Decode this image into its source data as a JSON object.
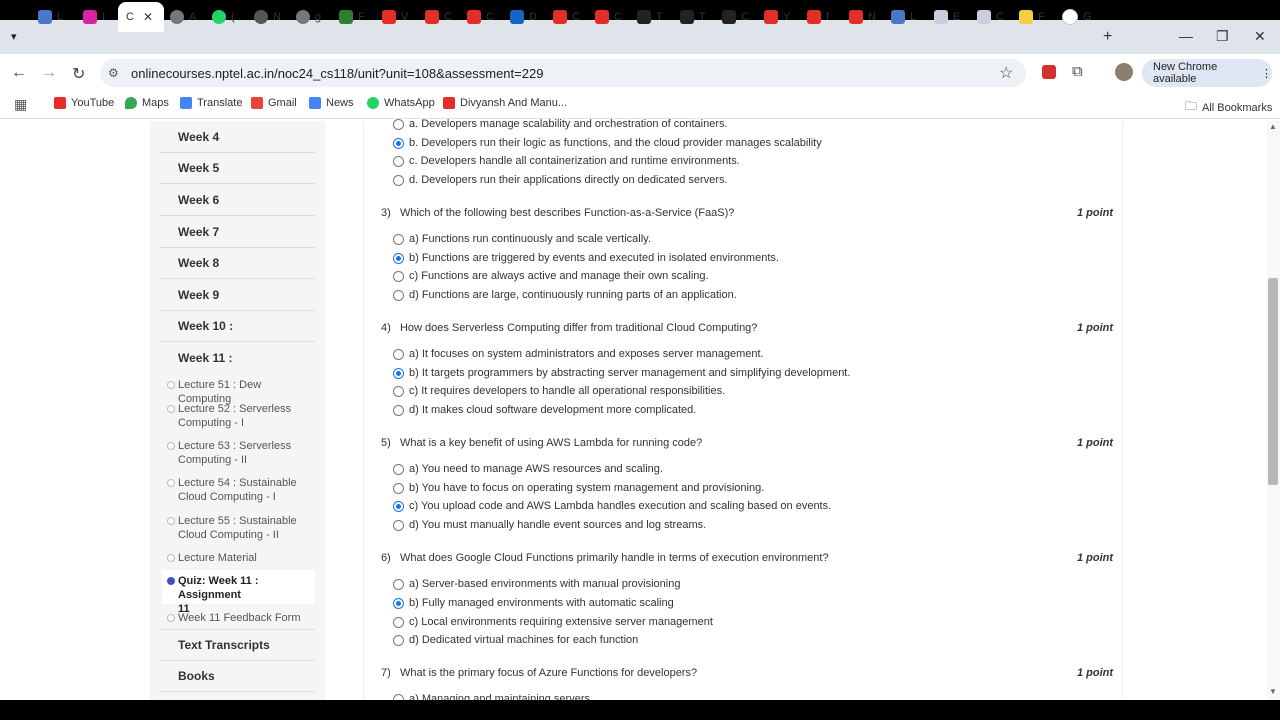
{
  "browser": {
    "tabs": [
      {
        "label": "L"
      },
      {
        "label": "I"
      },
      {
        "label": "C"
      },
      {
        "label": "A"
      },
      {
        "label": "("
      },
      {
        "label": "N"
      },
      {
        "label": "g"
      },
      {
        "label": "F"
      },
      {
        "label": "V"
      },
      {
        "label": "C"
      },
      {
        "label": "C"
      },
      {
        "label": "D"
      },
      {
        "label": "C"
      },
      {
        "label": "C"
      },
      {
        "label": "T"
      },
      {
        "label": "T"
      },
      {
        "label": "C"
      },
      {
        "label": "Y"
      },
      {
        "label": "f"
      },
      {
        "label": "N"
      },
      {
        "label": "L"
      },
      {
        "label": "E"
      },
      {
        "label": "C"
      },
      {
        "label": "F"
      },
      {
        "label": "G"
      }
    ],
    "url": "onlinecourses.nptel.ac.in/noc24_cs118/unit?unit=108&assessment=229",
    "new_chrome": "New Chrome available",
    "bookmarks": [
      "YouTube",
      "Maps",
      "Translate",
      "Gmail",
      "News",
      "WhatsApp",
      "Divyansh And Manu..."
    ],
    "all_bookmarks": "All Bookmarks"
  },
  "sidebar": {
    "weeks": [
      "Week 4",
      "Week 5",
      "Week 6",
      "Week 7",
      "Week 8",
      "Week 9",
      "Week 10 :",
      "Week 11 :"
    ],
    "lectures": [
      {
        "line1": "Lecture 51 : Dew Computing",
        "line2": ""
      },
      {
        "line1": "Lecture 52 : Serverless",
        "line2": "Computing - I"
      },
      {
        "line1": "Lecture 53 : Serverless",
        "line2": "Computing - II"
      },
      {
        "line1": "Lecture 54 : Sustainable",
        "line2": "Cloud Computing - I"
      },
      {
        "line1": "Lecture 55 : Sustainable",
        "line2": "Cloud Computing - II"
      },
      {
        "line1": "Lecture Material",
        "line2": ""
      },
      {
        "line1": "Quiz: Week 11 : Assignment",
        "line2": "11"
      },
      {
        "line1": "Week 11 Feedback Form",
        "line2": ""
      }
    ],
    "text_transcripts": "Text Transcripts",
    "books": "Books"
  },
  "quiz": {
    "point_label": "1 point",
    "q2_options": [
      "a. Developers manage scalability and orchestration of containers.",
      "b. Developers run their logic as functions, and the cloud provider manages scalability",
      "c. Developers handle all containerization and runtime environments.",
      "d. Developers run their applications directly on dedicated servers."
    ],
    "questions": [
      {
        "number": "3)",
        "text": "Which of the following best describes Function-as-a-Service (FaaS)?",
        "options": [
          "a) Functions run continuously and scale vertically.",
          "b) Functions are triggered by events and executed in isolated environments.",
          "c) Functions are always active and manage their own scaling.",
          "d) Functions are large, continuously running parts of an application."
        ]
      },
      {
        "number": "4)",
        "text": "How does Serverless Computing differ from traditional Cloud Computing?",
        "options": [
          "a) It focuses on system administrators and exposes server management.",
          "b) It targets programmers by abstracting server management and simplifying development.",
          "c) It requires developers to handle all operational responsibilities.",
          "d) It makes cloud software development more complicated."
        ]
      },
      {
        "number": "5)",
        "text": "What is a key benefit of using AWS Lambda for running code?",
        "options": [
          "a) You need to manage AWS resources and scaling.",
          "b) You have to focus on operating system management and provisioning.",
          "c) You upload code and AWS Lambda handles execution and scaling based on events.",
          "d) You must manually handle event sources and log streams."
        ]
      },
      {
        "number": "6)",
        "text": "What does Google Cloud Functions primarily handle in terms of execution environment?",
        "options": [
          "a) Server-based environments with manual provisioning",
          "b) Fully managed environments with automatic scaling",
          "c) Local environments requiring extensive server management",
          "d) Dedicated virtual machines for each function"
        ]
      },
      {
        "number": "7)",
        "text": "What is the primary focus of Azure Functions for developers?",
        "options": [
          "a) Managing and maintaining servers"
        ]
      }
    ]
  }
}
